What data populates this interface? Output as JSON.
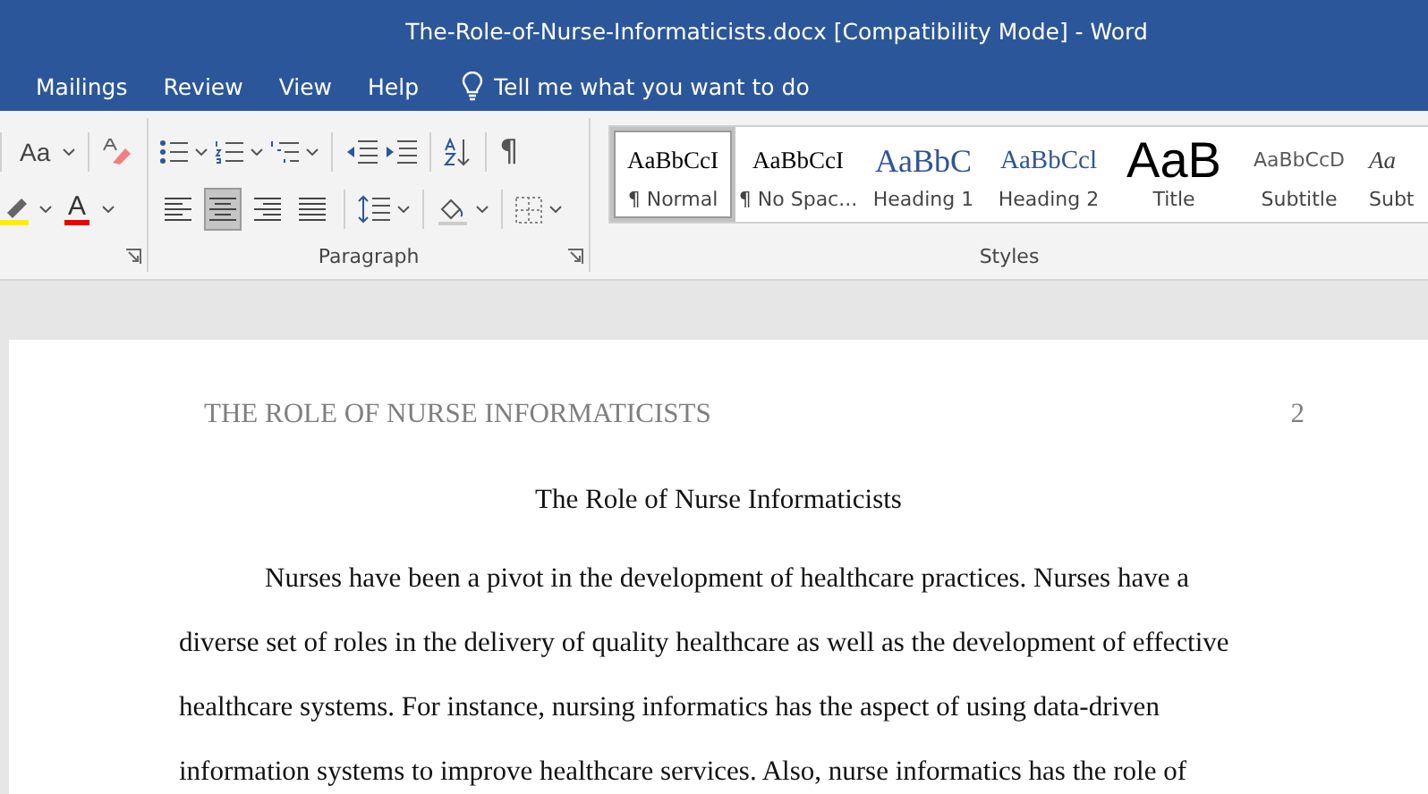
{
  "window": {
    "title": "The-Role-of-Nurse-Informaticists.docx [Compatibility Mode]  -  Word"
  },
  "tabs": [
    {
      "label": "Mailings",
      "selected": false
    },
    {
      "label": "Review",
      "selected": false
    },
    {
      "label": "View",
      "selected": false
    },
    {
      "label": "Help",
      "selected": false
    }
  ],
  "tell_me": {
    "placeholder": "Tell me what you want to do"
  },
  "font_group": {
    "change_case": "Aa",
    "font_color": "A"
  },
  "paragraph_group": {
    "label": "Paragraph",
    "pilcrow": "¶",
    "alignment": [
      {
        "kind": "left",
        "selected": false
      },
      {
        "kind": "center",
        "selected": true
      },
      {
        "kind": "right",
        "selected": false
      },
      {
        "kind": "justify",
        "selected": false
      }
    ]
  },
  "styles_group": {
    "label": "Styles",
    "items": [
      {
        "sample": "AaBbCcI",
        "name": "¶ Normal",
        "kind": "normal",
        "selected": true
      },
      {
        "sample": "AaBbCcI",
        "name": "¶ No Spac...",
        "kind": "normal",
        "selected": false
      },
      {
        "sample": "AaBbC",
        "name": "Heading 1",
        "kind": "heading1",
        "selected": false
      },
      {
        "sample": "AaBbCcl",
        "name": "Heading 2",
        "kind": "heading2",
        "selected": false
      },
      {
        "sample": "AaB",
        "name": "Title",
        "kind": "title",
        "selected": false
      },
      {
        "sample": "AaBbCcD",
        "name": "Subtitle",
        "kind": "subtitle",
        "selected": false
      },
      {
        "sample": "Aa",
        "name": "Subt",
        "kind": "emphasis",
        "selected": false
      }
    ]
  },
  "document": {
    "header": "THE ROLE OF NURSE INFORMATICISTS",
    "page_number": "2",
    "title": "The Role of Nurse Informaticists",
    "paragraph_lines": [
      "Nurses have been a pivot in the development of healthcare practices. Nurses have a",
      "diverse set of roles in the delivery of quality healthcare as well as the development of effective",
      "healthcare systems. For instance, nursing informatics has the aspect of using data-driven",
      "information systems to improve healthcare services. Also, nurse informatics has the role of"
    ]
  }
}
